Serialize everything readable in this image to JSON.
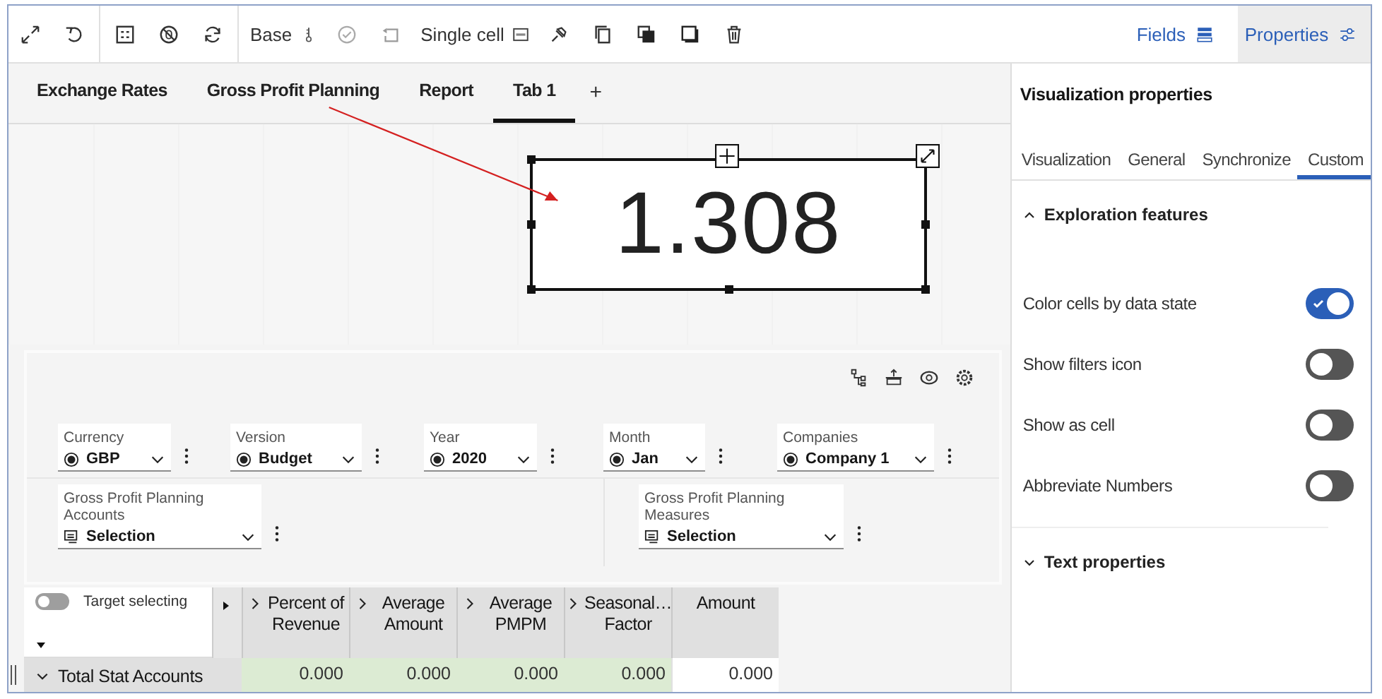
{
  "toolbar": {
    "base_label": "Base",
    "mode_label": "Single cell",
    "fields_button": {
      "label": "Fields",
      "selected": false
    },
    "properties_button": {
      "label": "Properties",
      "selected": true
    }
  },
  "tabs": [
    {
      "label": "Exchange Rates",
      "selected": false
    },
    {
      "label": "Gross Profit Planning",
      "selected": false
    },
    {
      "label": "Report",
      "selected": false
    },
    {
      "label": "Tab 1",
      "selected": true
    }
  ],
  "add_tab": "+",
  "kpi": {
    "value": "1.308"
  },
  "filters": [
    {
      "label": "Currency",
      "value": "GBP"
    },
    {
      "label": "Version",
      "value": "Budget"
    },
    {
      "label": "Year",
      "value": "2020"
    },
    {
      "label": "Month",
      "value": "Jan"
    },
    {
      "label": "Companies",
      "value": "Company 1"
    }
  ],
  "dimension_filters": [
    {
      "label": "Gross Profit Planning Accounts",
      "value": "Selection"
    },
    {
      "label": "Gross Profit Planning Measures",
      "value": "Selection"
    }
  ],
  "target_selecting": {
    "label": "Target selecting",
    "on": false
  },
  "table": {
    "columns": [
      {
        "label": "Percent of Revenue",
        "expandable": true
      },
      {
        "label": "Average Amount",
        "expandable": true
      },
      {
        "label": "Average PMPM",
        "expandable": true
      },
      {
        "label": "Seasonal… Factor",
        "expandable": true
      },
      {
        "label": "Amount",
        "expandable": false
      }
    ],
    "rows": [
      {
        "label": "Total Stat Accounts",
        "expanded": true,
        "cells": [
          {
            "value": "0.000",
            "highlighted": true
          },
          {
            "value": "0.000",
            "highlighted": true
          },
          {
            "value": "0.000",
            "highlighted": true
          },
          {
            "value": "0.000",
            "highlighted": true
          },
          {
            "value": "0.000",
            "highlighted": false
          }
        ]
      }
    ]
  },
  "properties": {
    "title": "Visualization properties",
    "tabs": [
      {
        "label": "Visualization",
        "selected": false
      },
      {
        "label": "General",
        "selected": false
      },
      {
        "label": "Synchronize",
        "selected": false
      },
      {
        "label": "Custom",
        "selected": true
      }
    ],
    "sections": [
      {
        "title": "Exploration features",
        "expanded": true,
        "toggles": [
          {
            "label": "Color cells by data state",
            "on": true
          },
          {
            "label": "Show filters icon",
            "on": false
          },
          {
            "label": "Show as cell",
            "on": false
          },
          {
            "label": "Abbreviate Numbers",
            "on": false
          }
        ]
      },
      {
        "title": "Text properties",
        "expanded": false
      }
    ]
  }
}
